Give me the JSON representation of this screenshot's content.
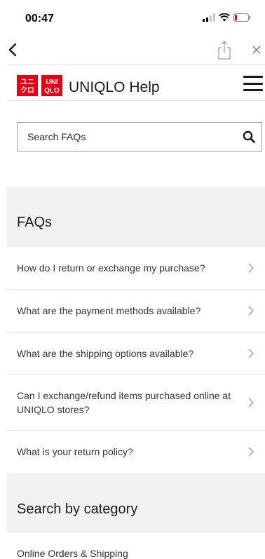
{
  "status_bar": {
    "time": "00:47"
  },
  "header": {
    "title": "UNIQLO Help",
    "logo_top": "ユニ\nクロ",
    "logo_bottom": "UNI\nQLO"
  },
  "search": {
    "placeholder": "Search FAQs",
    "value": ""
  },
  "faq_section": {
    "title": "FAQs",
    "items": [
      {
        "label": "How do I return or exchange my purchase?"
      },
      {
        "label": "What are the payment methods available?"
      },
      {
        "label": "What are the shipping options available?"
      },
      {
        "label": "Can I exchange/refund items purchased online at UNIQLO stores?"
      },
      {
        "label": "What is your return policy?"
      }
    ]
  },
  "category_section": {
    "title": "Search by category",
    "first_item": "Online Orders & Shipping"
  },
  "colors": {
    "brand_red": "#e60012",
    "band_gray": "#f1f1f1",
    "divider": "#e0e0e0"
  },
  "icons": [
    "back-icon",
    "share-icon",
    "close-icon",
    "hamburger-menu-icon",
    "search-icon",
    "chevron-right-icon"
  ]
}
